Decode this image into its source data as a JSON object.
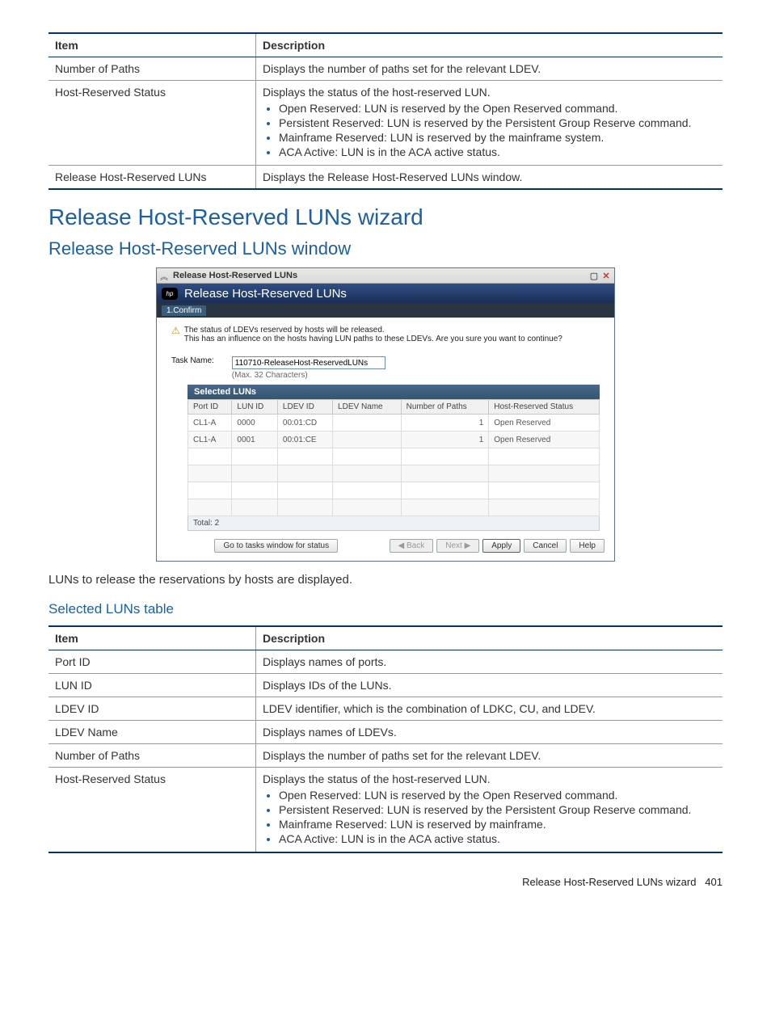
{
  "table1": {
    "headers": [
      "Item",
      "Description"
    ],
    "rows": [
      {
        "item": "Number of Paths",
        "desc": "Displays the number of paths set for the relevant LDEV."
      },
      {
        "item": "Host-Reserved Status",
        "desc": "Displays the status of the host-reserved LUN.",
        "bullets": [
          "Open Reserved: LUN is reserved by the Open Reserved command.",
          "Persistent Reserved: LUN is reserved by the Persistent Group Reserve command.",
          "Mainframe Reserved: LUN is reserved by the mainframe system.",
          "ACA Active: LUN is in the ACA active status."
        ]
      },
      {
        "item": "Release Host-Reserved LUNs",
        "desc": "Displays the Release Host-Reserved LUNs window."
      }
    ]
  },
  "h1": "Release Host-Reserved LUNs wizard",
  "h2": "Release Host-Reserved LUNs window",
  "dialog": {
    "win_title": "Release Host-Reserved LUNs",
    "title": "Release Host-Reserved LUNs",
    "step": "1.Confirm",
    "warn_line1": "The status of LDEVs reserved by hosts will be released.",
    "warn_line2": "This has an influence on the hosts having LUN paths to these LDEVs. Are you sure you want to continue?",
    "task_label": "Task Name:",
    "task_value": "110710-ReleaseHost-ReservedLUNs",
    "task_hint": "(Max. 32 Characters)",
    "selected_title": "Selected LUNs",
    "grid_headers": [
      "Port ID",
      "LUN ID",
      "LDEV ID",
      "LDEV Name",
      "Number of Paths",
      "Host-Reserved Status"
    ],
    "grid_rows": [
      {
        "port": "CL1-A",
        "lun": "0000",
        "ldev": "00:01:CD",
        "name": "",
        "paths": "1",
        "status": "Open Reserved"
      },
      {
        "port": "CL1-A",
        "lun": "0001",
        "ldev": "00:01:CE",
        "name": "",
        "paths": "1",
        "status": "Open Reserved"
      }
    ],
    "total": "Total: 2",
    "btn_tasks": "Go to tasks window for status",
    "btn_back": "◀ Back",
    "btn_next": "Next ▶",
    "btn_apply": "Apply",
    "btn_cancel": "Cancel",
    "btn_help": "Help"
  },
  "intro": "LUNs to release the reservations by hosts are displayed.",
  "h3": "Selected LUNs table",
  "table2": {
    "headers": [
      "Item",
      "Description"
    ],
    "rows": [
      {
        "item": "Port ID",
        "desc": "Displays names of ports."
      },
      {
        "item": "LUN ID",
        "desc": "Displays IDs of the LUNs."
      },
      {
        "item": "LDEV ID",
        "desc": "LDEV identifier, which is the combination of LDKC, CU, and LDEV."
      },
      {
        "item": "LDEV Name",
        "desc": "Displays names of LDEVs."
      },
      {
        "item": "Number of Paths",
        "desc": "Displays the number of paths set for the relevant LDEV."
      },
      {
        "item": "Host-Reserved Status",
        "desc": "Displays the status of the host-reserved LUN.",
        "bullets": [
          "Open Reserved: LUN is reserved by the Open Reserved command.",
          "Persistent Reserved: LUN is reserved by the Persistent Group Reserve command.",
          "Mainframe Reserved: LUN is reserved by mainframe.",
          "ACA Active: LUN is in the ACA active status."
        ]
      }
    ]
  },
  "footer": {
    "text": "Release Host-Reserved LUNs wizard",
    "page": "401"
  }
}
